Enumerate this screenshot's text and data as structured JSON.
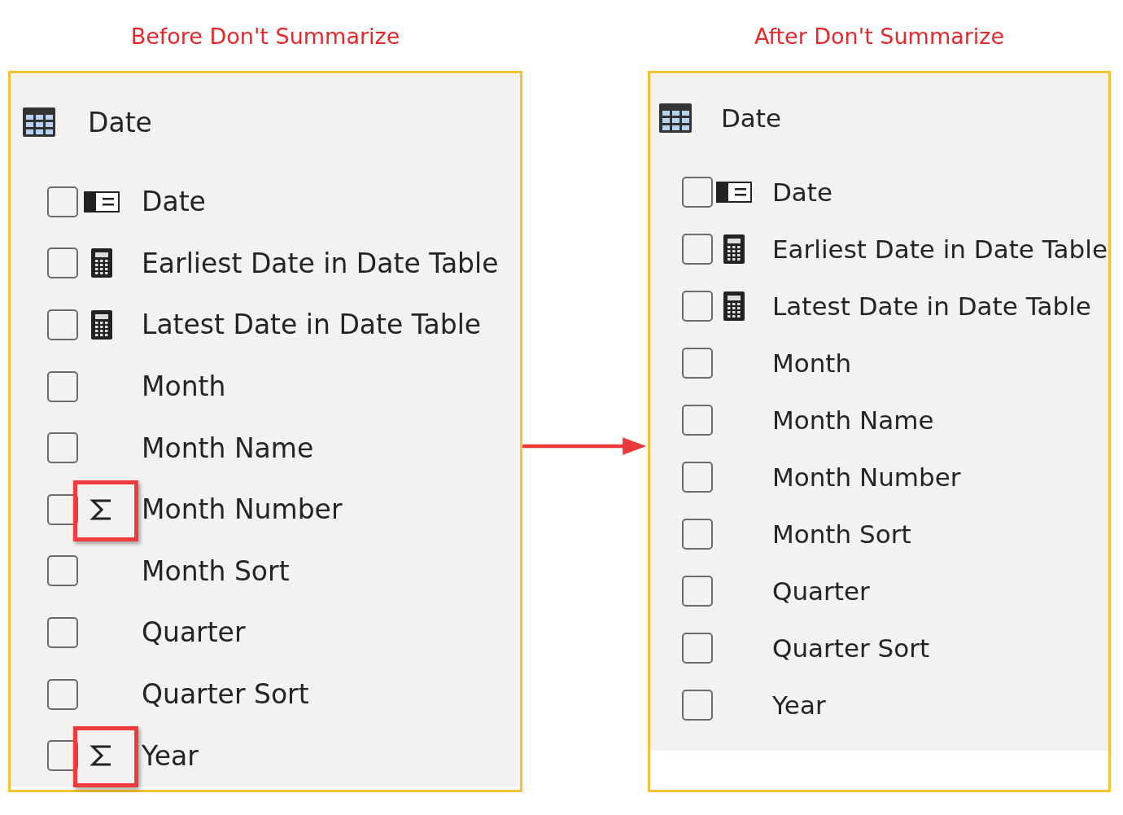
{
  "panels": [
    {
      "caption": "Before Don't Summarize",
      "table": "Date",
      "fields": [
        {
          "name": "Date",
          "kind": "date",
          "checked": false,
          "highlighted": false
        },
        {
          "name": "Earliest Date in Date Table",
          "kind": "calc",
          "checked": false,
          "highlighted": false
        },
        {
          "name": "Latest Date in Date Table",
          "kind": "calc",
          "checked": false,
          "highlighted": false
        },
        {
          "name": "Month",
          "kind": "none",
          "checked": false,
          "highlighted": false
        },
        {
          "name": "Month Name",
          "kind": "none",
          "checked": false,
          "highlighted": false
        },
        {
          "name": "Month Number",
          "kind": "sigma",
          "checked": false,
          "highlighted": true
        },
        {
          "name": "Month Sort",
          "kind": "none",
          "checked": false,
          "highlighted": false
        },
        {
          "name": "Quarter",
          "kind": "none",
          "checked": false,
          "highlighted": false
        },
        {
          "name": "Quarter Sort",
          "kind": "none",
          "checked": false,
          "highlighted": false
        },
        {
          "name": "Year",
          "kind": "sigma",
          "checked": false,
          "highlighted": true
        }
      ]
    },
    {
      "caption": "After Don't Summarize",
      "table": "Date",
      "fields": [
        {
          "name": "Date",
          "kind": "date",
          "checked": false,
          "highlighted": false
        },
        {
          "name": "Earliest Date in Date Table",
          "kind": "calc",
          "checked": false,
          "highlighted": false
        },
        {
          "name": "Latest Date in Date Table",
          "kind": "calc",
          "checked": false,
          "highlighted": false
        },
        {
          "name": "Month",
          "kind": "none",
          "checked": false,
          "highlighted": false
        },
        {
          "name": "Month Name",
          "kind": "none",
          "checked": false,
          "highlighted": false
        },
        {
          "name": "Month Number",
          "kind": "none",
          "checked": false,
          "highlighted": false
        },
        {
          "name": "Month Sort",
          "kind": "none",
          "checked": false,
          "highlighted": false
        },
        {
          "name": "Quarter",
          "kind": "none",
          "checked": false,
          "highlighted": false
        },
        {
          "name": "Quarter Sort",
          "kind": "none",
          "checked": false,
          "highlighted": false
        },
        {
          "name": "Year",
          "kind": "none",
          "checked": false,
          "highlighted": false
        }
      ]
    }
  ]
}
